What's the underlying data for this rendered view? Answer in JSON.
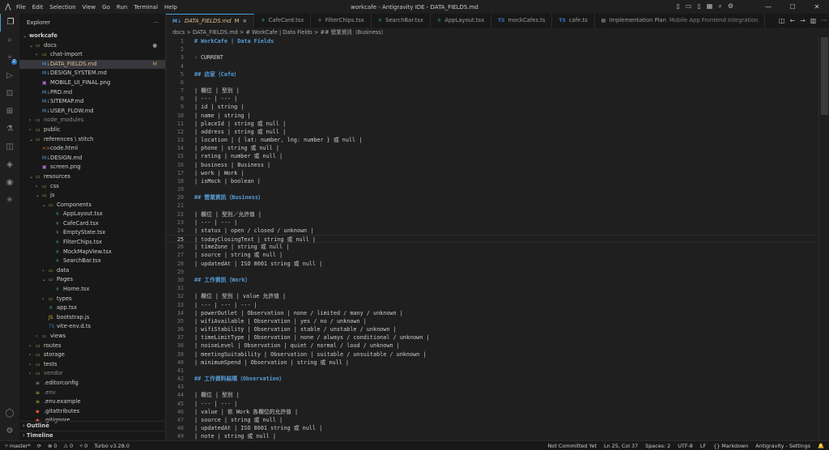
{
  "window": {
    "title": "workcafe - Antigravity IDE - DATA_FIELDS.md",
    "menu": [
      "File",
      "Edit",
      "Selection",
      "View",
      "Go",
      "Run",
      "Terminal",
      "Help"
    ],
    "controls": {
      "min": "—",
      "max": "☐",
      "close": "✕"
    }
  },
  "activity_badge": "2",
  "sidebar": {
    "title": "Explorer",
    "root": "workcafe",
    "items": [
      {
        "label": "docs",
        "type": "folder",
        "open": true,
        "depth": 1,
        "dot": "●"
      },
      {
        "label": "chat-import",
        "type": "folder",
        "open": false,
        "depth": 2
      },
      {
        "label": "DATA_FIELDS.md",
        "type": "md",
        "depth": 2,
        "selected": true,
        "badge": "M"
      },
      {
        "label": "DESIGN_SYSTEM.md",
        "type": "md",
        "depth": 2
      },
      {
        "label": "MOBILE_UI_FINAL.png",
        "type": "img",
        "depth": 2
      },
      {
        "label": "PRD.md",
        "type": "md",
        "depth": 2
      },
      {
        "label": "SITEMAP.md",
        "type": "md",
        "depth": 2
      },
      {
        "label": "USER_FLOW.md",
        "type": "md",
        "depth": 2
      },
      {
        "label": "node_modules",
        "type": "folder",
        "open": false,
        "depth": 1,
        "dim": true
      },
      {
        "label": "public",
        "type": "folder",
        "open": false,
        "depth": 1
      },
      {
        "label": "references \\ stitch",
        "type": "folder",
        "open": true,
        "depth": 1
      },
      {
        "label": "code.html",
        "type": "html",
        "depth": 2
      },
      {
        "label": "DESIGN.md",
        "type": "md",
        "depth": 2
      },
      {
        "label": "screen.png",
        "type": "img",
        "depth": 2
      },
      {
        "label": "resources",
        "type": "folder",
        "open": true,
        "depth": 1
      },
      {
        "label": "css",
        "type": "folder",
        "open": false,
        "depth": 2
      },
      {
        "label": "js",
        "type": "folder",
        "open": true,
        "depth": 2
      },
      {
        "label": "Components",
        "type": "folder",
        "open": true,
        "depth": 3
      },
      {
        "label": "AppLayout.tsx",
        "type": "tsx",
        "depth": 4
      },
      {
        "label": "CafeCard.tsx",
        "type": "tsx",
        "depth": 4
      },
      {
        "label": "EmptyState.tsx",
        "type": "tsx",
        "depth": 4
      },
      {
        "label": "FilterChips.tsx",
        "type": "tsx",
        "depth": 4
      },
      {
        "label": "MockMapView.tsx",
        "type": "tsx",
        "depth": 4
      },
      {
        "label": "SearchBar.tsx",
        "type": "tsx",
        "depth": 4
      },
      {
        "label": "data",
        "type": "folder",
        "open": false,
        "depth": 3
      },
      {
        "label": "Pages",
        "type": "folder",
        "open": true,
        "depth": 3
      },
      {
        "label": "Home.tsx",
        "type": "tsx",
        "depth": 4
      },
      {
        "label": "types",
        "type": "folder",
        "open": false,
        "depth": 3
      },
      {
        "label": "app.tsx",
        "type": "tsx",
        "depth": 3
      },
      {
        "label": "bootstrap.js",
        "type": "js",
        "depth": 3
      },
      {
        "label": "vite-env.d.ts",
        "type": "ts",
        "depth": 3
      },
      {
        "label": "views",
        "type": "folder",
        "open": false,
        "depth": 2
      },
      {
        "label": "routes",
        "type": "folder",
        "open": false,
        "depth": 1
      },
      {
        "label": "storage",
        "type": "folder",
        "open": false,
        "depth": 1
      },
      {
        "label": "tests",
        "type": "folder",
        "open": false,
        "depth": 1
      },
      {
        "label": "vendor",
        "type": "folder",
        "open": false,
        "depth": 1,
        "dim": true
      },
      {
        "label": ".editorconfig",
        "type": "cfg",
        "depth": 1
      },
      {
        "label": ".env",
        "type": "env",
        "depth": 1,
        "dim": true
      },
      {
        "label": ".env.example",
        "type": "env",
        "depth": 1
      },
      {
        "label": ".gitattributes",
        "type": "git",
        "depth": 1
      },
      {
        "label": ".gitignore",
        "type": "git",
        "depth": 1
      }
    ],
    "outline": "Outline",
    "timeline": "Timeline"
  },
  "tabs": [
    {
      "label": "DATA_FIELDS.md",
      "icon": "md",
      "suffix": "M",
      "active": true
    },
    {
      "label": "CafeCard.tsx",
      "icon": "tsx"
    },
    {
      "label": "FilterChips.tsx",
      "icon": "tsx"
    },
    {
      "label": "SearchBar.tsx",
      "icon": "tsx"
    },
    {
      "label": "AppLayout.tsx",
      "icon": "tsx"
    },
    {
      "label": "mockCafes.ts",
      "icon": "ts"
    },
    {
      "label": "cafe.ts",
      "icon": "ts"
    },
    {
      "label": "Implementation Plan",
      "sub": "Mobile App Frontend Integration",
      "icon": "doc"
    }
  ],
  "breadcrumb": "docs  >  DATA_FIELDS.md  >  # WorkCafe | Data Fields  >  ## 營業資訊（Business）",
  "editor": {
    "lens": "CURRENT",
    "cursor_line": 25,
    "lines": [
      {
        "n": 1,
        "t": "# WorkCafe | Data Fields",
        "h": true
      },
      {
        "n": 2,
        "t": ""
      },
      {
        "n": 3,
        "t": ""
      },
      {
        "n": 4,
        "t": ""
      },
      {
        "n": 5,
        "t": "## 店家（Cafe）",
        "h": true
      },
      {
        "n": 6,
        "t": ""
      },
      {
        "n": 7,
        "t": "| 欄位 | 型別 |"
      },
      {
        "n": 8,
        "t": "| --- | --- |"
      },
      {
        "n": 9,
        "t": "| id | string |"
      },
      {
        "n": 10,
        "t": "| name | string |"
      },
      {
        "n": 11,
        "t": "| placeId | string 或 null |"
      },
      {
        "n": 12,
        "t": "| address | string 或 null |"
      },
      {
        "n": 13,
        "t": "| location | { lat: number, lng: number } 或 null |"
      },
      {
        "n": 14,
        "t": "| phone | string 或 null |"
      },
      {
        "n": 15,
        "t": "| rating | number 或 null |"
      },
      {
        "n": 16,
        "t": "| business | Business |"
      },
      {
        "n": 17,
        "t": "| work | Work |"
      },
      {
        "n": 18,
        "t": "| isMock | boolean |"
      },
      {
        "n": 19,
        "t": ""
      },
      {
        "n": 20,
        "t": "## 營業資訊（Business）",
        "h": true
      },
      {
        "n": 21,
        "t": ""
      },
      {
        "n": 22,
        "t": "| 欄位 | 型別／允許值 |"
      },
      {
        "n": 23,
        "t": "| --- | --- |"
      },
      {
        "n": 24,
        "t": "| status | open / closed / unknown |"
      },
      {
        "n": 25,
        "t": "| todayClosingText | string 或 null |"
      },
      {
        "n": 26,
        "t": "| timeZone | string 或 null |"
      },
      {
        "n": 27,
        "t": "| source | string 或 null |"
      },
      {
        "n": 28,
        "t": "| updatedAt | ISO 8601 string 或 null |"
      },
      {
        "n": 29,
        "t": ""
      },
      {
        "n": 30,
        "t": "## 工作資訊（Work）",
        "h": true
      },
      {
        "n": 31,
        "t": ""
      },
      {
        "n": 32,
        "t": "| 欄位 | 型別 | value 允許值 |"
      },
      {
        "n": 33,
        "t": "| --- | --- | --- |"
      },
      {
        "n": 34,
        "t": "| powerOutlet | Observation | none / limited / many / unknown |"
      },
      {
        "n": 35,
        "t": "| wifiAvailable | Observation | yes / no / unknown |"
      },
      {
        "n": 36,
        "t": "| wifiStability | Observation | stable / unstable / unknown |"
      },
      {
        "n": 37,
        "t": "| timeLimitType | Observation | none / always / conditional / unknown |"
      },
      {
        "n": 38,
        "t": "| noiseLevel | Observation | quiet / normal / loud / unknown |"
      },
      {
        "n": 39,
        "t": "| meetingSuitability | Observation | suitable / unsuitable / unknown |"
      },
      {
        "n": 40,
        "t": "| minimumSpend | Observation | string 或 null |"
      },
      {
        "n": 41,
        "t": ""
      },
      {
        "n": 42,
        "t": "## 工作資料結構（Observation）",
        "h": true
      },
      {
        "n": 43,
        "t": ""
      },
      {
        "n": 44,
        "t": "| 欄位 | 型別 |"
      },
      {
        "n": 45,
        "t": "| --- | --- |"
      },
      {
        "n": 46,
        "t": "| value | 依 Work 各欄位的允許值 |"
      },
      {
        "n": 47,
        "t": "| source | string 或 null |"
      },
      {
        "n": 48,
        "t": "| updatedAt | ISO 8601 string 或 null |"
      },
      {
        "n": 49,
        "t": "| note | string 或 null |"
      }
    ]
  },
  "statusbar": {
    "branch": "master*",
    "sync": "⟳",
    "errors": "⊗ 0",
    "warnings": "⚠ 0",
    "ports": "⑂ 0",
    "turbo": "Turbo v3.28.0",
    "commit": "Not Committed Yet",
    "position": "Ln 25, Col 37",
    "spaces": "Spaces: 2",
    "encoding": "UTF-8",
    "eol": "LF",
    "language": "{} Markdown",
    "settings": "Antigravity - Settings"
  },
  "colors": {
    "accent": "#4a9cd6",
    "modified": "#e2c08d",
    "heading": "#569cd6"
  }
}
